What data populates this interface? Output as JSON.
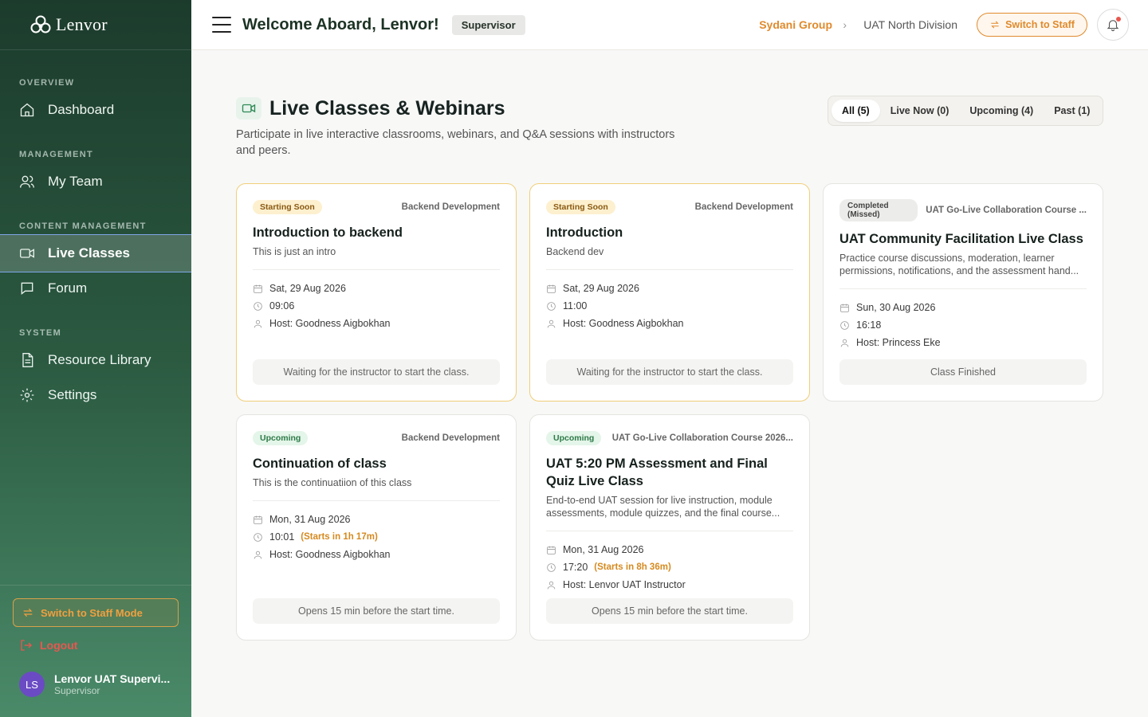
{
  "app": {
    "logo_text": "Lenvor"
  },
  "sidebar": {
    "sections": {
      "overview": "OVERVIEW",
      "management": "MANAGEMENT",
      "content": "CONTENT MANAGEMENT",
      "system": "SYSTEM"
    },
    "items": {
      "dashboard": "Dashboard",
      "my_team": "My Team",
      "live_classes": "Live Classes",
      "forum": "Forum",
      "resource_library": "Resource Library",
      "settings": "Settings"
    },
    "switch_label": "Switch to Staff Mode",
    "logout_label": "Logout",
    "user": {
      "initials": "LS",
      "name": "Lenvor UAT Supervi...",
      "role": "Supervisor"
    }
  },
  "header": {
    "welcome": "Welcome Aboard, Lenvor!",
    "role_badge": "Supervisor",
    "breadcrumb_org": "Sydani Group",
    "breadcrumb_sep": "›",
    "breadcrumb_division": "UAT North Division",
    "switch_label": "Switch to Staff"
  },
  "page": {
    "title": "Live Classes & Webinars",
    "subtitle": "Participate in live interactive classrooms, webinars, and Q&A sessions with instructors and peers."
  },
  "filters": [
    "All (5)",
    "Live Now (0)",
    "Upcoming (4)",
    "Past (1)"
  ],
  "cards": [
    {
      "status": "Starting Soon",
      "course": "Backend Development",
      "title": "Introduction to backend",
      "description": "This is just an intro",
      "date": "Sat, 29 Aug 2026",
      "time": "09:06",
      "starts_in": "",
      "host": "Host: Goodness Aigbokhan",
      "footer": "Waiting for the instructor to start the class."
    },
    {
      "status": "Starting Soon",
      "course": "Backend Development",
      "title": "Introduction",
      "description": "Backend dev",
      "date": "Sat, 29 Aug 2026",
      "time": "11:00",
      "starts_in": "",
      "host": "Host: Goodness Aigbokhan",
      "footer": "Waiting for the instructor to start the class."
    },
    {
      "status": "Completed (Missed)",
      "course": "UAT Go-Live Collaboration Course ...",
      "title": "UAT Community Facilitation Live Class",
      "description": "Practice course discussions, moderation, learner permissions, notifications, and the assessment hand...",
      "date": "Sun, 30 Aug 2026",
      "time": "16:18",
      "starts_in": "",
      "host": "Host: Princess Eke",
      "footer": "Class Finished"
    },
    {
      "status": "Upcoming",
      "course": "Backend Development",
      "title": "Continuation of class",
      "description": "This is the continuatiion of this class",
      "date": "Mon, 31 Aug 2026",
      "time": "10:01",
      "starts_in": "(Starts in 1h 17m)",
      "host": "Host: Goodness Aigbokhan",
      "footer": "Opens 15 min before the start time."
    },
    {
      "status": "Upcoming",
      "course": "UAT Go-Live Collaboration Course 2026...",
      "title": "UAT 5:20 PM Assessment and Final Quiz Live Class",
      "description": "End-to-end UAT session for live instruction, module assessments, module quizzes, and the final course...",
      "date": "Mon, 31 Aug 2026",
      "time": "17:20",
      "starts_in": "(Starts in 8h 36m)",
      "host": "Host: Lenvor UAT Instructor",
      "footer": "Opens 15 min before the start time."
    }
  ]
}
